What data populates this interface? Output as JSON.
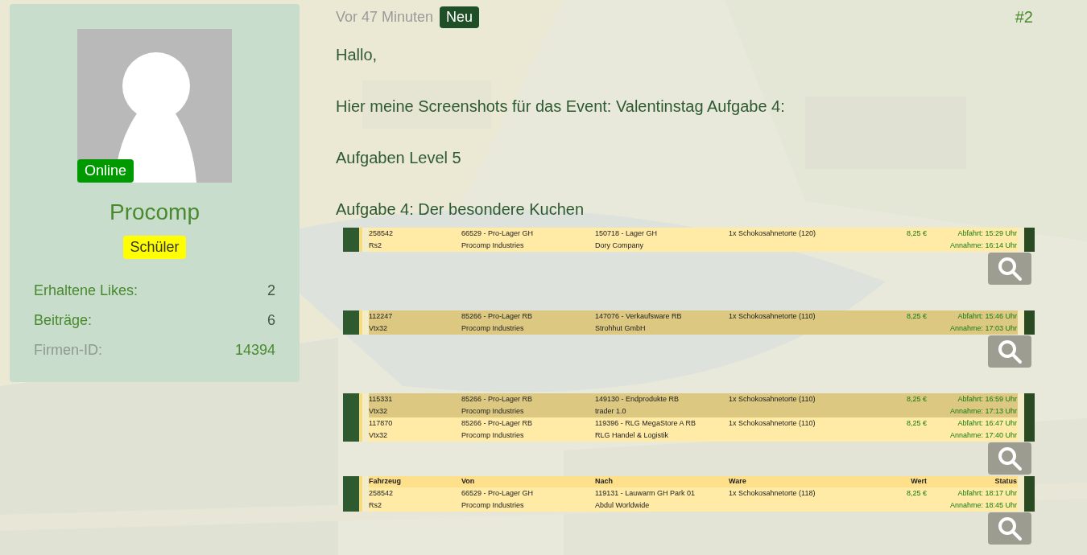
{
  "profile": {
    "status": "Online",
    "name": "Procomp",
    "rank": "Schüler",
    "stats": [
      {
        "kind": "stat",
        "label": "Erhaltene Likes:",
        "value": "2"
      },
      {
        "kind": "stat",
        "label": "Beiträge:",
        "value": "6"
      },
      {
        "kind": "id",
        "label": "Firmen-ID:",
        "value": "14394"
      }
    ]
  },
  "post": {
    "time": "Vor 47 Minuten",
    "badge": "Neu",
    "number": "#2",
    "paragraphs": [
      "Hallo,",
      "Hier meine Screenshots für das Event: Valentinstag Aufgabe 4:",
      "Aufgaben Level 5",
      "Aufgabe 4: Der besondere Kuchen"
    ],
    "screenshots": [
      {
        "rows": [
          {
            "selected": false,
            "vehicle": "258542",
            "vehicle_type": "Rs2",
            "from": "66529 - Pro-Lager GH",
            "sender": "Procomp Industries",
            "to": "150718 - Lager GH",
            "receiver": "Dory Company",
            "goods": "1x Schokosahnetorte (120)",
            "value": "8,25 €",
            "departure": "Abfahrt: 15:29 Uhr",
            "arrival": "Annahme: 16:14 Uhr"
          }
        ]
      },
      {
        "rows": [
          {
            "selected": true,
            "vehicle": "112247",
            "vehicle_type": "Vtx32",
            "from": "85266 - Pro-Lager RB",
            "sender": "Procomp Industries",
            "to": "147076 - Verkaufsware RB",
            "receiver": "Strohhut GmbH",
            "goods": "1x Schokosahnetorte (110)",
            "value": "8,25 €",
            "departure": "Abfahrt: 15:46 Uhr",
            "arrival": "Annahme: 17:03 Uhr"
          }
        ]
      },
      {
        "rows": [
          {
            "selected": true,
            "vehicle": "115331",
            "vehicle_type": "Vtx32",
            "from": "85266 - Pro-Lager RB",
            "sender": "Procomp Industries",
            "to": "149130 - Endprodukte RB",
            "receiver": "trader 1.0",
            "goods": "1x Schokosahnetorte (110)",
            "value": "8,25 €",
            "departure": "Abfahrt: 16:59 Uhr",
            "arrival": "Annahme: 17:13 Uhr"
          },
          {
            "selected": false,
            "vehicle": "117870",
            "vehicle_type": "Vtx32",
            "from": "85266 - Pro-Lager RB",
            "sender": "Procomp Industries",
            "to": "119396 - RLG MegaStore A RB",
            "receiver": "RLG Handel & Logistik",
            "goods": "1x Schokosahnetorte (110)",
            "value": "8,25 €",
            "departure": "Abfahrt: 16:47 Uhr",
            "arrival": "Annahme: 17:40 Uhr"
          }
        ]
      },
      {
        "columns": [
          "Fahrzeug",
          "Von",
          "Nach",
          "Ware",
          "Wert",
          "Status"
        ],
        "rows": [
          {
            "selected": false,
            "vehicle": "258542",
            "vehicle_type": "Rs2",
            "from": "66529 - Pro-Lager GH",
            "sender": "Procomp Industries",
            "to": "119131 - Lauwarm GH Park 01",
            "receiver": "Abdul Worldwide",
            "goods": "1x Schokosahnetorte (118)",
            "value": "8,25 €",
            "departure": "Abfahrt: 18:17 Uhr",
            "arrival": "Annahme: 18:45 Uhr"
          }
        ]
      }
    ]
  }
}
